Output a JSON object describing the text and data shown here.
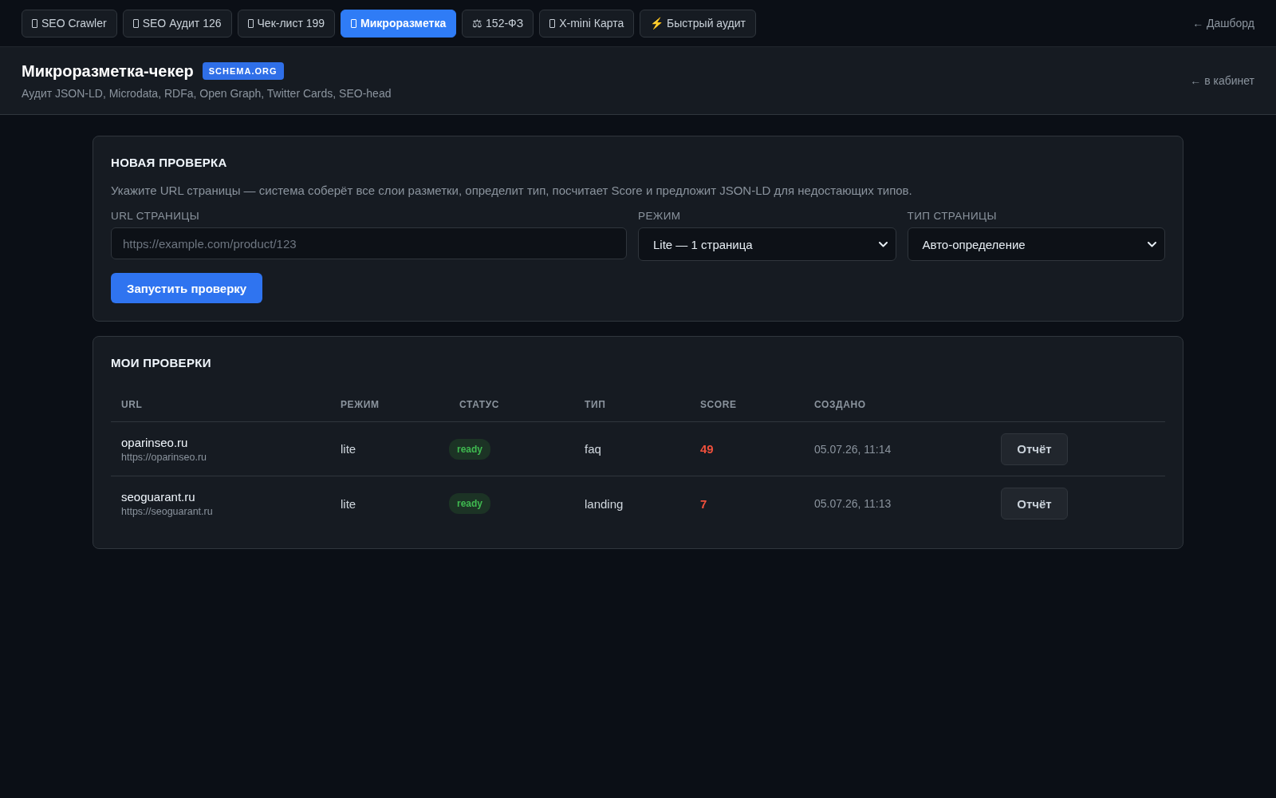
{
  "nav": {
    "tabs": [
      {
        "label": "SEO Crawler",
        "kind": "boxed",
        "selected": false
      },
      {
        "label": "SEO Аудит 126",
        "kind": "boxed",
        "selected": false
      },
      {
        "label": "Чек-лист 199",
        "kind": "boxed",
        "selected": false
      },
      {
        "label": "Микроразметка",
        "kind": "boxed",
        "selected": true
      },
      {
        "label": "⚖ 152-ФЗ",
        "kind": "plain",
        "selected": false
      },
      {
        "label": "X-mini Карта",
        "kind": "boxed",
        "selected": false
      },
      {
        "label": "⚡ Быстрый аудит",
        "kind": "plain",
        "selected": false
      }
    ],
    "back_link": "← Дашборд"
  },
  "header": {
    "title": "Микроразметка-чекер",
    "badge": "SCHEMA.ORG",
    "subtitle": "Аудит JSON-LD, Microdata, RDFa, Open Graph, Twitter Cards, SEO-head",
    "back_link": "← в кабинет"
  },
  "new_check": {
    "title": "НОВАЯ ПРОВЕРКА",
    "description": "Укажите URL страницы — система соберёт все слои разметки, определит тип, посчитает Score и предложит JSON-LD для недостающих типов.",
    "fields": [
      {
        "kind": "input",
        "label": "URL СТРАНИЦЫ",
        "placeholder": "https://example.com/product/123"
      },
      {
        "kind": "select",
        "label": "РЕЖИМ",
        "value": "Lite — 1 страница"
      },
      {
        "kind": "select",
        "label": "ТИП СТРАНИЦЫ",
        "value": "Авто-определение"
      }
    ],
    "submit": "Запустить проверку"
  },
  "my_checks": {
    "title": "МОИ ПРОВЕРКИ",
    "table": {
      "columns": [
        "URL",
        "РЕЖИМ",
        "СТАТУС",
        "ТИП",
        "SCORE",
        "СОЗДАНО"
      ],
      "rows": [
        {
          "domain": "oparinseo.ru",
          "url": "https://oparinseo.ru",
          "mode": "lite",
          "status": "ready",
          "type": "faq",
          "score": "49",
          "created": "05.07.26, 11:14",
          "action": "Отчёт"
        },
        {
          "domain": "seoguarant.ru",
          "url": "https://seoguarant.ru",
          "mode": "lite",
          "status": "ready",
          "type": "landing",
          "score": "7",
          "created": "05.07.26, 11:13",
          "action": "Отчёт"
        }
      ]
    }
  }
}
